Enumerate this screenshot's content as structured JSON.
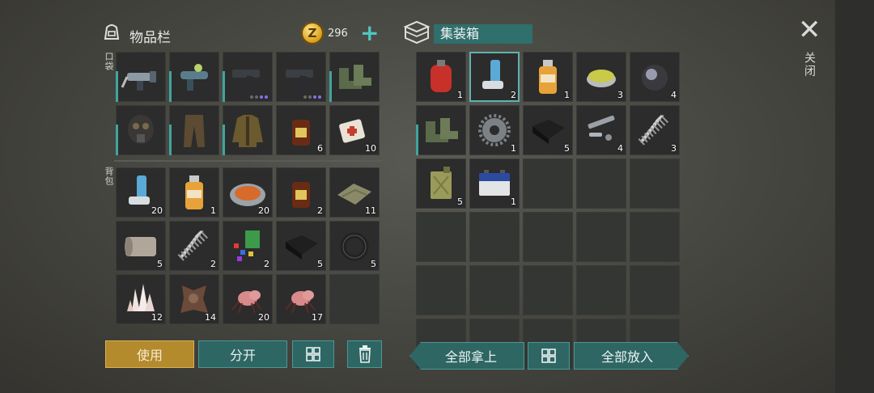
{
  "inventory": {
    "title": "物品栏",
    "coins": "296",
    "pocket_label": "口袋",
    "backpack_label": "背包",
    "pocket_items": [
      {
        "icon": "drill-icon",
        "count": ""
      },
      {
        "icon": "water-gun-icon",
        "count": ""
      },
      {
        "icon": "pistol-icon",
        "count": ""
      },
      {
        "icon": "pistol-icon",
        "count": ""
      },
      {
        "icon": "boots-icon",
        "count": ""
      },
      {
        "icon": "gas-mask-icon",
        "count": ""
      },
      {
        "icon": "pants-icon",
        "count": ""
      },
      {
        "icon": "jacket-icon",
        "count": ""
      },
      {
        "icon": "bottle-icon",
        "count": "6"
      },
      {
        "icon": "bandage-icon",
        "count": "10"
      }
    ],
    "backpack_items": [
      {
        "icon": "inhaler-icon",
        "count": "20"
      },
      {
        "icon": "orange-bottle-icon",
        "count": "1"
      },
      {
        "icon": "food-plate-icon",
        "count": "20"
      },
      {
        "icon": "bottle-icon",
        "count": "2"
      },
      {
        "icon": "cloth-icon",
        "count": "11"
      },
      {
        "icon": "leather-roll-icon",
        "count": "5"
      },
      {
        "icon": "spring-icon",
        "count": "2"
      },
      {
        "icon": "gems-icon",
        "count": "2"
      },
      {
        "icon": "black-cloth-icon",
        "count": "5"
      },
      {
        "icon": "rubber-ring-icon",
        "count": "5"
      },
      {
        "icon": "crystal-icon",
        "count": "12"
      },
      {
        "icon": "hide-icon",
        "count": "14"
      },
      {
        "icon": "spider-icon",
        "count": "20"
      },
      {
        "icon": "spider-icon",
        "count": "17"
      },
      {
        "icon": "",
        "count": ""
      }
    ]
  },
  "container": {
    "title": "集装箱",
    "items": [
      {
        "icon": "gas-canister-icon",
        "count": "1"
      },
      {
        "icon": "inhaler-icon",
        "count": "2"
      },
      {
        "icon": "orange-bottle-icon",
        "count": "1"
      },
      {
        "icon": "salve-tin-icon",
        "count": "3"
      },
      {
        "icon": "lens-icon",
        "count": "4"
      },
      {
        "icon": "boots-icon",
        "count": ""
      },
      {
        "icon": "gear-icon",
        "count": "1"
      },
      {
        "icon": "black-cloth-icon",
        "count": "5"
      },
      {
        "icon": "pipe-parts-icon",
        "count": "4"
      },
      {
        "icon": "spring-icon",
        "count": "3"
      },
      {
        "icon": "jerrycan-icon",
        "count": "5"
      },
      {
        "icon": "battery-icon",
        "count": "1"
      }
    ]
  },
  "buttons": {
    "use": "使用",
    "split": "分开",
    "take_all": "全部拿上",
    "put_all": "全部放入"
  },
  "close_label": "关闭"
}
